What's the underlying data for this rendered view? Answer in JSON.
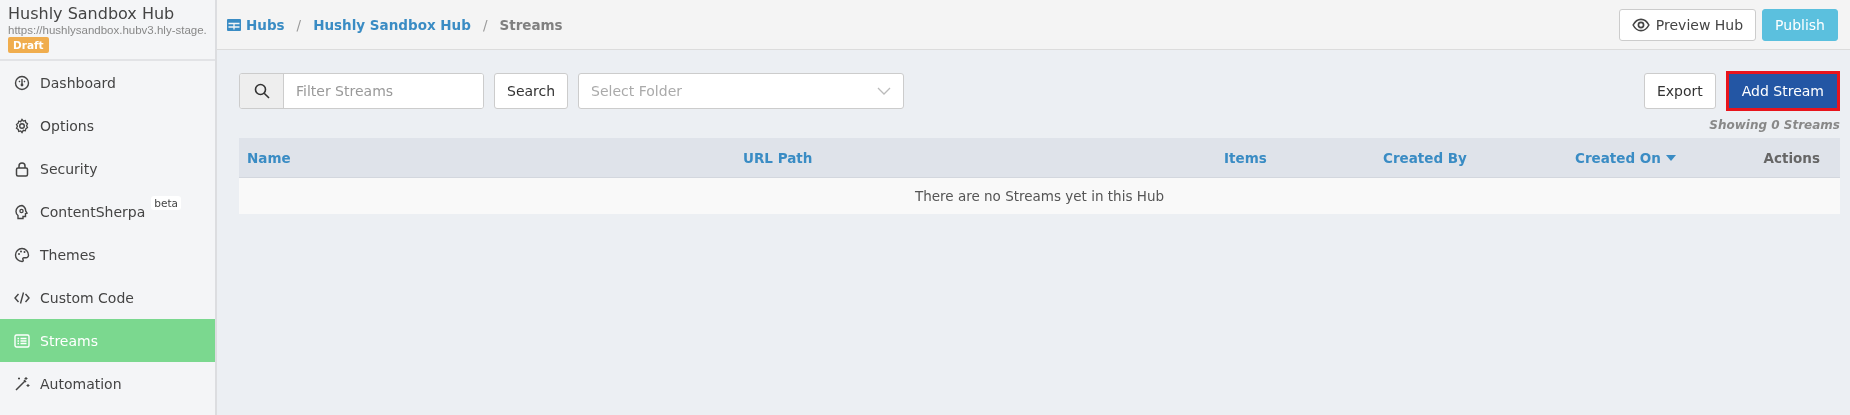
{
  "hub": {
    "title": "Hushly Sandbox Hub",
    "url": "https://hushlysandbox.hubv3.hly-stage.",
    "status": "Draft"
  },
  "sidebar": {
    "items": [
      {
        "label": "Dashboard",
        "selected": false
      },
      {
        "label": "Options",
        "selected": false
      },
      {
        "label": "Security",
        "selected": false
      },
      {
        "label": "ContentSherpa",
        "badge": "beta",
        "selected": false
      },
      {
        "label": "Themes",
        "selected": false
      },
      {
        "label": "Custom Code",
        "selected": false
      },
      {
        "label": "Streams",
        "selected": true
      },
      {
        "label": "Automation",
        "selected": false
      }
    ]
  },
  "breadcrumb": [
    {
      "label": "Hubs",
      "link": true
    },
    {
      "separator": "/",
      "label": "Hushly Sandbox Hub",
      "link": true
    },
    {
      "separator": "/",
      "label": "Streams",
      "link": false
    }
  ],
  "header_buttons": [
    {
      "kind": "outline",
      "label": "Preview Hub"
    },
    {
      "kind": "info",
      "label": "Publish"
    }
  ],
  "toolbar": {
    "filter": {
      "placeholder": "Filter Streams"
    },
    "search_button": "Search",
    "folder_select": {
      "placeholder": "Select Folder"
    },
    "export_button": "Export",
    "add_button": {
      "label": "Add Stream",
      "highlighted": true
    }
  },
  "count": "Showing 0 Streams",
  "table": {
    "columns": [
      {
        "label": "Name",
        "sortable": true,
        "sorted": false
      },
      {
        "label": "URL Path",
        "sortable": true,
        "sorted": false
      },
      {
        "label": "Items",
        "sortable": true,
        "sorted": false
      },
      {
        "label": "Created By",
        "sortable": true,
        "sorted": false
      },
      {
        "label": "Created On",
        "sortable": true,
        "sorted": true
      },
      {
        "label": "Actions",
        "sortable": false,
        "sorted": false
      }
    ],
    "empty_message": "There are no Streams yet in this Hub"
  }
}
